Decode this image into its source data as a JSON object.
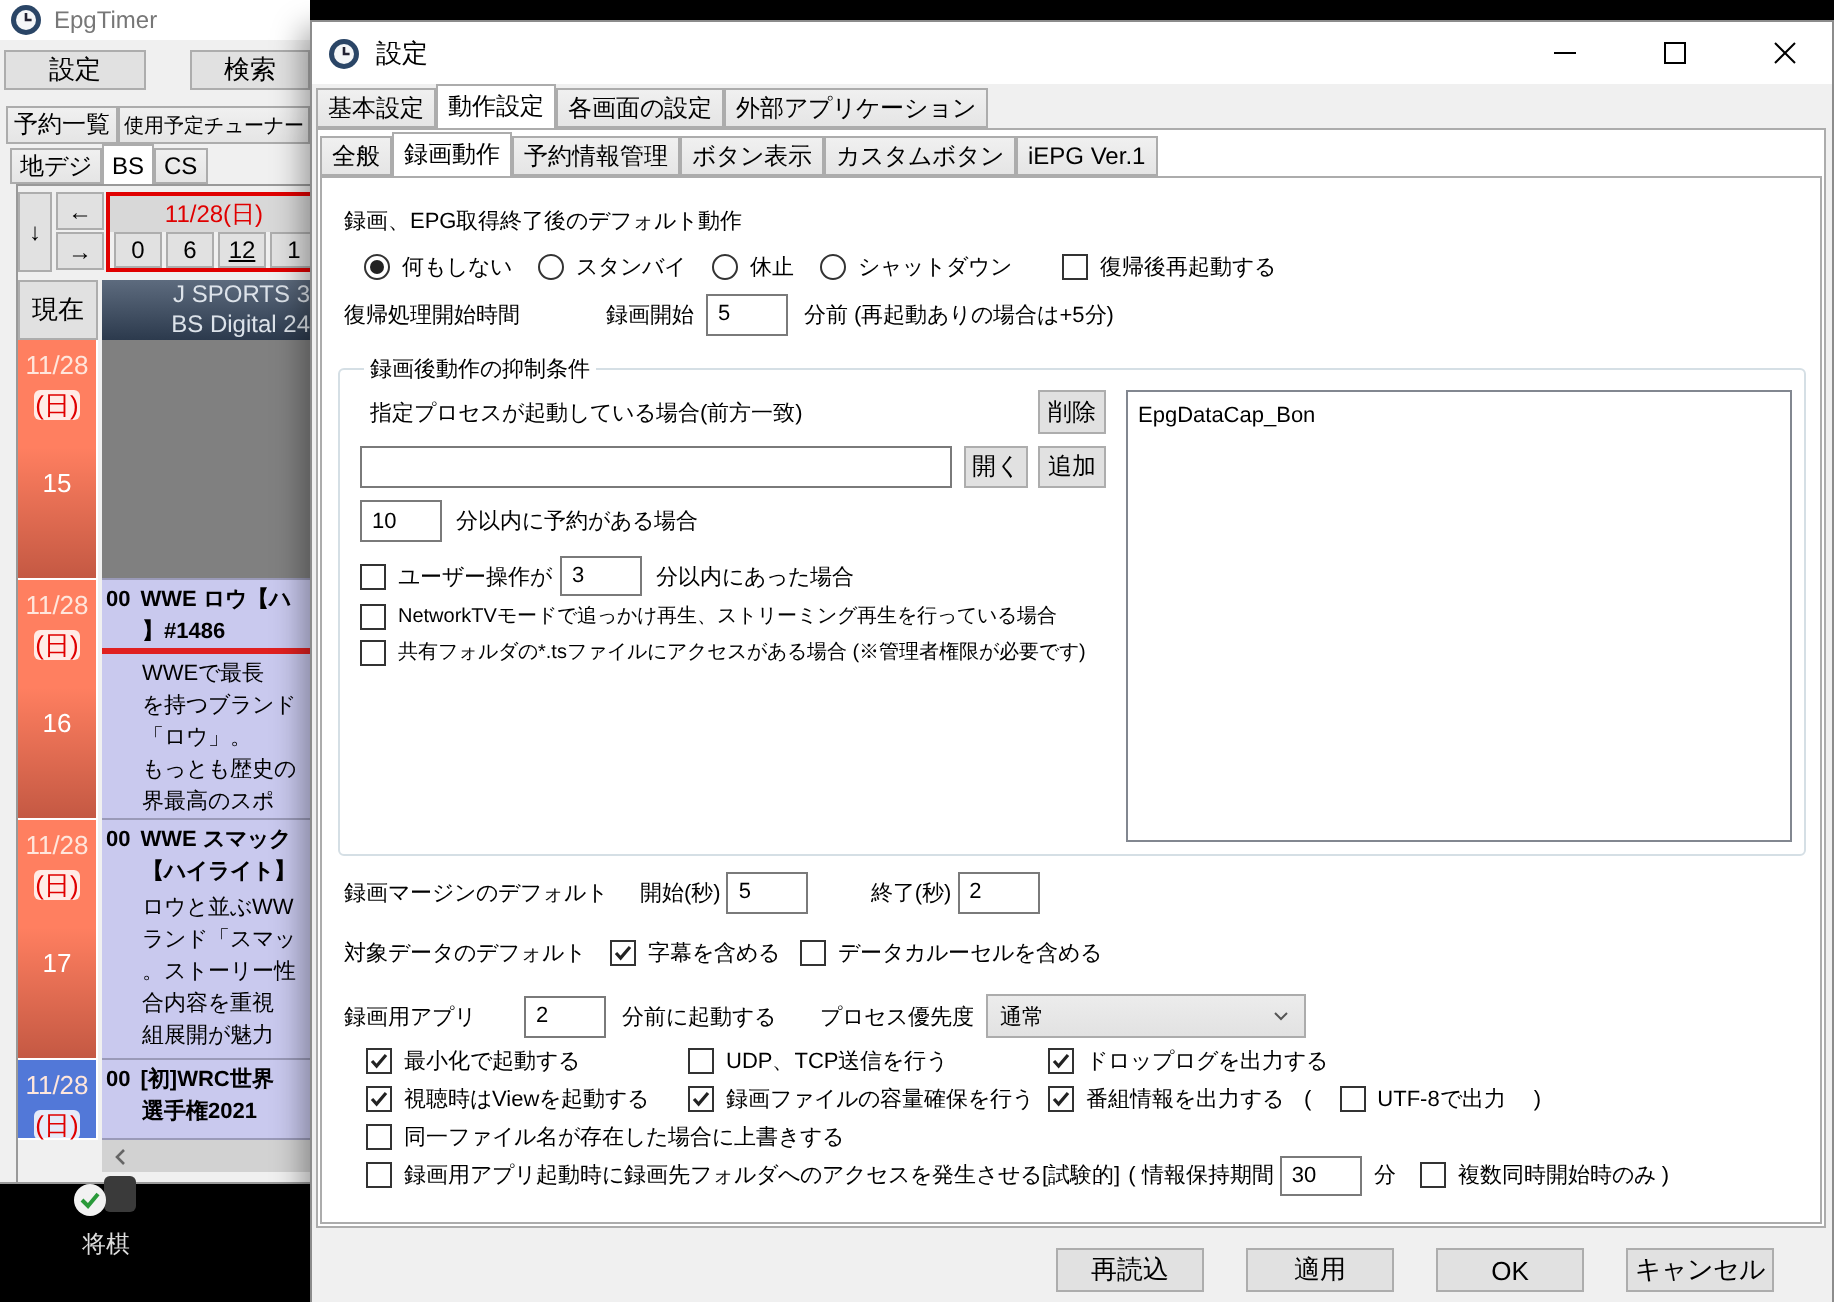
{
  "main_window": {
    "title": "EpgTimer",
    "buttons": [
      "設定",
      "検索"
    ],
    "tabs": [
      {
        "label": "予約一覧",
        "selected": false
      },
      {
        "label": "使用予定チューナー",
        "selected": false
      }
    ],
    "epg_tabs": [
      {
        "label": "地デジ",
        "selected": false
      },
      {
        "label": "BS",
        "selected": true
      },
      {
        "label": "CS",
        "selected": false
      }
    ],
    "nav": {
      "down": "↓",
      "left": "←",
      "right": "→",
      "now": "現在"
    },
    "date_header": "11/28(日)",
    "hours": [
      {
        "label": "0",
        "underlined": false
      },
      {
        "label": "6",
        "underlined": false
      },
      {
        "label": "12",
        "underlined": true
      },
      {
        "label": "1",
        "underlined": false
      }
    ],
    "service": {
      "name": "J SPORTS 3",
      "network": "BS Digital 24"
    },
    "time_rows": [
      {
        "date": "11/28",
        "day": "(日)",
        "hour": "15",
        "color": "#ff7f60"
      },
      {
        "date": "11/28",
        "day": "(日)",
        "hour": "16",
        "color": "#ff7f60",
        "program": {
          "minute": "00",
          "title": [
            "WWE ロウ【ハ",
            "】#1486"
          ],
          "current": true,
          "description": [
            "WWEで最長",
            "を持つブランド",
            "「ロウ」。",
            "もっとも歴史の",
            "界最高のスポ"
          ]
        }
      },
      {
        "date": "11/28",
        "day": "(日)",
        "hour": "17",
        "color": "#ff7f60",
        "program": {
          "minute": "00",
          "title": [
            "WWE スマック",
            "【ハイライト】"
          ],
          "current": false,
          "description": [
            "ロウと並ぶWW",
            "ランド「スマッ",
            "。ストーリー性",
            "合内容を重視",
            "組展開が魅力"
          ]
        }
      },
      {
        "date": "11/28",
        "day": "(日)",
        "color": "#5278d8",
        "program": {
          "minute": "00",
          "title": [
            "[初]WRC世界",
            "選手権2021"
          ],
          "current": false
        }
      }
    ]
  },
  "desktop_icon": {
    "label": "将棋"
  },
  "dialog": {
    "title": "設定",
    "tabs": [
      {
        "label": "基本設定",
        "selected": false
      },
      {
        "label": "動作設定",
        "selected": true
      },
      {
        "label": "各画面の設定",
        "selected": false
      },
      {
        "label": "外部アプリケーション",
        "selected": false
      }
    ],
    "subtabs": [
      {
        "label": "全般",
        "selected": false
      },
      {
        "label": "録画動作",
        "selected": true
      },
      {
        "label": "予約情報管理",
        "selected": false
      },
      {
        "label": "ボタン表示",
        "selected": false
      },
      {
        "label": "カスタムボタン",
        "selected": false
      },
      {
        "label": "iEPG Ver.1",
        "selected": false
      }
    ],
    "default_action": {
      "label": "録画、EPG取得終了後のデフォルト動作",
      "options": [
        {
          "label": "何もしない",
          "selected": true
        },
        {
          "label": "スタンバイ",
          "selected": false
        },
        {
          "label": "休止",
          "selected": false
        },
        {
          "label": "シャットダウン",
          "selected": false
        }
      ],
      "reboot": {
        "label": "復帰後再起動する",
        "checked": false
      }
    },
    "resume": {
      "label": "復帰処理開始時間",
      "field_label": "録画開始",
      "value": "5",
      "suffix": "分前 (再起動ありの場合は+5分)"
    },
    "suppress": {
      "legend": "録画後動作の抑制条件",
      "process_label": "指定プロセスが起動している場合(前方一致)",
      "delete_button": "削除",
      "open_button": "開く",
      "add_button": "追加",
      "process_list": [
        "EpgDataCap_Bon"
      ],
      "reserve": {
        "value": "10",
        "suffix": "分以内に予約がある場合"
      },
      "user_op": {
        "label": "ユーザー操作が",
        "checked": false,
        "value": "3",
        "suffix": "分以内にあった場合"
      },
      "options": [
        {
          "label": "NetworkTVモードで追っかけ再生、ストリーミング再生を行っている場合",
          "checked": false
        },
        {
          "label": "共有フォルダの*.tsファイルにアクセスがある場合 (※管理者権限が必要です)",
          "checked": false
        }
      ]
    },
    "margin": {
      "label": "録画マージンのデフォルト",
      "start_label": "開始(秒)",
      "start": "5",
      "end_label": "終了(秒)",
      "end": "2"
    },
    "data": {
      "label": "対象データのデフォルト",
      "options": [
        {
          "label": "字幕を含める",
          "checked": true
        },
        {
          "label": "データカルーセルを含める",
          "checked": false
        }
      ]
    },
    "app": {
      "label": "録画用アプリ",
      "value": "2",
      "suffix": "分前に起動する",
      "priority_label": "プロセス優先度",
      "priority": "通常"
    },
    "app_options": [
      {
        "label": "最小化で起動する",
        "checked": true
      },
      {
        "label": "UDP、TCP送信を行う",
        "checked": false
      },
      {
        "label": "ドロップログを出力する",
        "checked": true
      },
      {
        "label": "視聴時はViewを起動する",
        "checked": true
      },
      {
        "label": "録画ファイルの容量確保を行う",
        "checked": true
      },
      {
        "label": "番組情報を出力する",
        "checked": true
      }
    ],
    "utf8": {
      "open": "(",
      "label": "UTF-8で出力",
      "checked": false,
      "close": ")"
    },
    "overwrite": {
      "label": "同一ファイル名が存在した場合に上書きする",
      "checked": false
    },
    "access": {
      "label": "録画用アプリ起動時に録画先フォルダへのアクセスを発生させる[試験的]",
      "checked": false,
      "period_label": "( 情報保持期間",
      "value": "30",
      "unit": "分",
      "multi": {
        "label": "複数同時開始時のみ )",
        "checked": false
      }
    },
    "buttons": [
      "再読込",
      "適用",
      "OK",
      "キャンセル"
    ]
  }
}
